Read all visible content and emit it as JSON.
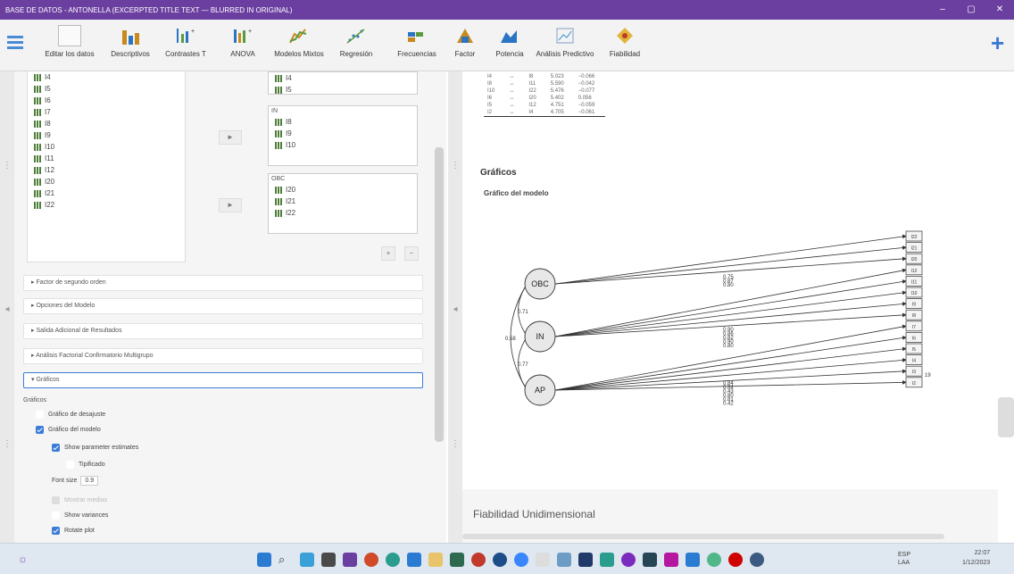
{
  "window": {
    "title": "BASE DE DATOS - ANTONELLA    (EXCERPTED TITLE TEXT — BLURRED IN ORIGINAL)",
    "minimize": "–",
    "maximize": "▢",
    "close": "✕"
  },
  "toolbar": {
    "items": [
      {
        "label": "Editar los datos",
        "icon": "data-editor-icon"
      },
      {
        "label": "Descriptivos",
        "icon": "bar-chart-icon"
      },
      {
        "label": "Contrastes T",
        "icon": "t-test-icon"
      },
      {
        "label": "ANOVA",
        "icon": "anova-icon"
      },
      {
        "label": "Modelos Mixtos",
        "icon": "mixed-models-icon"
      },
      {
        "label": "Regresión",
        "icon": "regression-icon"
      },
      {
        "label": "Frecuencias",
        "icon": "frequencies-icon"
      },
      {
        "label": "Factor",
        "icon": "factor-icon"
      },
      {
        "label": "Potencia",
        "icon": "power-icon"
      },
      {
        "label": "Análisis Predictivo",
        "icon": "predictive-icon"
      },
      {
        "label": "Fiabilidad",
        "icon": "reliability-icon"
      }
    ],
    "add": "+",
    "menu": "≡"
  },
  "variables": [
    "I4",
    "I5",
    "I6",
    "I7",
    "I8",
    "I9",
    "I10",
    "I11",
    "I12",
    "I20",
    "I21",
    "I22"
  ],
  "factor_boxes": [
    {
      "title": "",
      "items": [
        "I4",
        "I5"
      ]
    },
    {
      "title": "IN",
      "items": [
        "I8",
        "I9",
        "I10",
        "I11"
      ]
    },
    {
      "title": "OBC",
      "items": [
        "I20",
        "I21",
        "I22"
      ]
    }
  ],
  "box_buttons": {
    "add": "+",
    "remove": "−"
  },
  "sections": [
    "▸ Factor de segundo orden",
    "▸ Opciones del Modelo",
    "▸ Salida Adicional de Resultados",
    "▸ Análisis Factorial Confirmatorio Multigrupo",
    "▾ Gráficos"
  ],
  "graficos_options": {
    "header": "Gráficos",
    "items": [
      {
        "label": "Gráfico de desajuste",
        "checked": false
      },
      {
        "label": "Gráfico del modelo",
        "checked": true
      },
      {
        "label": "Show parameter estimates",
        "checked": true
      },
      {
        "label": "Tipificado",
        "checked": false
      },
      {
        "label": "Font size",
        "value": "0.9"
      },
      {
        "label": "Mostrar medias",
        "checked": false
      },
      {
        "label": "Show variances",
        "checked": false
      },
      {
        "label": "Rotate plot",
        "checked": true
      }
    ]
  },
  "results_table": {
    "rows": [
      [
        "I4",
        "↔",
        "I8",
        "5.023",
        "−0.066"
      ],
      [
        "I8",
        "↔",
        "I11",
        "5.590",
        "−0.042"
      ],
      [
        "I10",
        "↔",
        "I22",
        "5.476",
        "−0.077"
      ],
      [
        "I6",
        "↔",
        "I20",
        "5.402",
        "0.056"
      ],
      [
        "I5",
        "↔",
        "I12",
        "4.751",
        "−0.059"
      ],
      [
        "I2",
        "↔",
        "I4",
        "4.705",
        "−0.061"
      ]
    ]
  },
  "plots": {
    "heading": "Gráficos",
    "subheading": "Gráfico del modelo"
  },
  "model_graph": {
    "latent": [
      "OBC",
      "IN",
      "AP"
    ],
    "covariances": {
      "OBC-IN": "0.71",
      "IN-AP": "0.77",
      "OBC-AP": "0.58"
    },
    "indicators": [
      "I22",
      "I21",
      "I20",
      "I12",
      "I11",
      "I10",
      "I9",
      "I8",
      "I7",
      "I6",
      "I5",
      "I4",
      "I3",
      "I2"
    ],
    "loadings": {
      "OBC": [
        "0.75",
        "0.87",
        "0.80"
      ],
      "IN": [
        "0.90",
        "0.86",
        "0.82",
        "0.90",
        "0.80"
      ],
      "AP": [
        "0.84",
        "0.84",
        "0.43",
        "0.80",
        "0.81",
        "0.42"
      ]
    },
    "residual_label": "19"
  },
  "next_section_title": "Fiabilidad Unidimensional",
  "taskbar": {
    "lang": "ESP\nLAA",
    "time": "22:07",
    "date": "1/12/2023"
  }
}
